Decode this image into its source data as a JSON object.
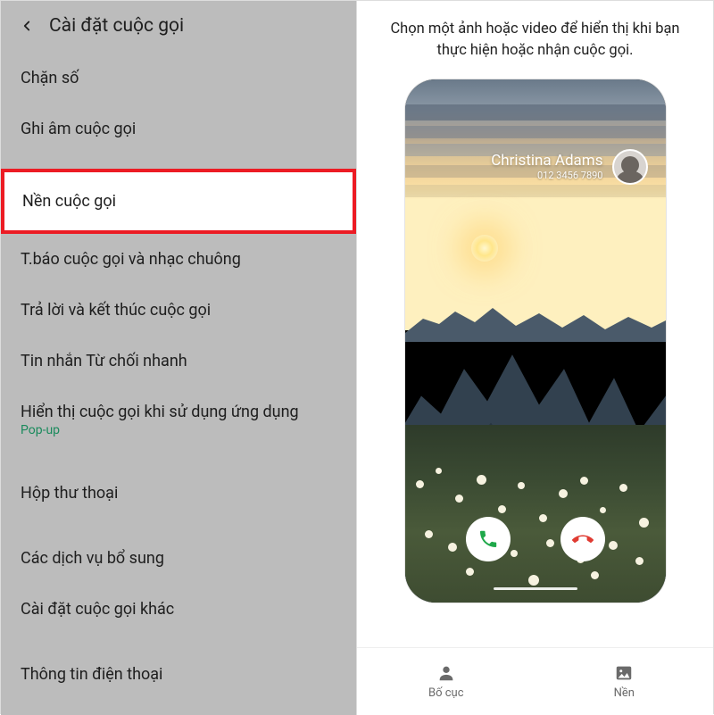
{
  "left": {
    "title": "Cài đặt cuộc gọi",
    "items": [
      {
        "label": "Chặn số"
      },
      {
        "label": "Ghi âm cuộc gọi"
      },
      {
        "label": "Nền cuộc gọi",
        "highlighted": true
      },
      {
        "label": "T.báo cuộc gọi và nhạc chuông"
      },
      {
        "label": "Trả lời và kết thúc cuộc gọi"
      },
      {
        "label": "Tin nhắn Từ chối nhanh"
      },
      {
        "label": "Hiển thị cuộc gọi khi sử dụng ứng dụng",
        "sub": "Pop-up"
      },
      {
        "label": "Hộp thư thoại"
      },
      {
        "label": "Các dịch vụ bổ sung"
      },
      {
        "label": "Cài đặt cuộc gọi khác"
      },
      {
        "label": "Thông tin điện thoại"
      }
    ]
  },
  "right": {
    "instruction": "Chọn một ảnh hoặc video để hiển thị khi bạn thực hiện hoặc nhận cuộc gọi.",
    "caller_name": "Christina Adams",
    "caller_number": "012 3456 7890",
    "tabs": {
      "layout": "Bố cục",
      "background": "Nền"
    }
  },
  "colors": {
    "highlight_border": "#ec1c24",
    "accept_call": "#1fa84a",
    "decline_call": "#e03b32",
    "popup_sub": "#1a8a5c"
  }
}
